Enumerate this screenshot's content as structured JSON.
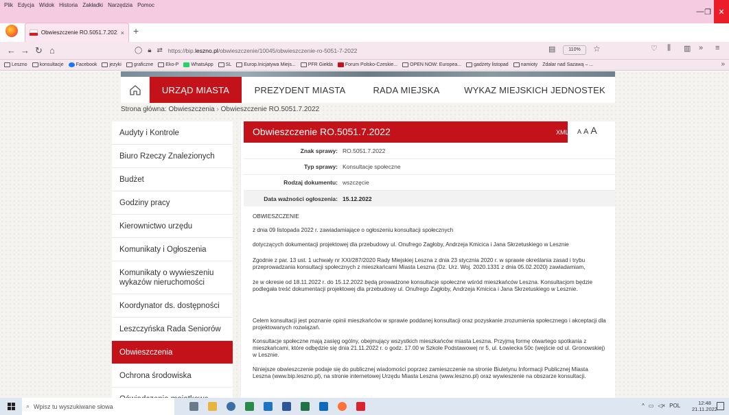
{
  "browser": {
    "menu": [
      "Plik",
      "Edycja",
      "Widok",
      "Historia",
      "Zakładki",
      "Narzędzia",
      "Pomoc"
    ],
    "tab_title": "Obwieszczenie RO.5051.7.2022",
    "tab_close": "×",
    "new_tab": "+",
    "url_prefix": "https://bip.",
    "url_domain": "leszno.pl",
    "url_path": "/obwieszczenie/10045/obwieszczenie-ro-5051-7-2022",
    "zoom": "110%",
    "bookmarks": [
      "Leszno",
      "konsultacje",
      "Facebook",
      "jezyki",
      "graficzne",
      "Eko-P",
      "WhatsApp",
      "SL",
      "Europ.Inicjatywa Miejs...",
      "PFR Giełda",
      "Forum Polsko-Czeskie...",
      "OPEN NOW: Europea...",
      "gadżety listopad",
      "namioty",
      "Zdalar nad Sazawą – ..."
    ]
  },
  "nav": {
    "items": [
      "URZĄD MIASTA",
      "PREZYDENT MIASTA",
      "RADA MIEJSKA",
      "WYKAZ MIEJSKICH JEDNOSTEK"
    ]
  },
  "breadcrumb": {
    "root": "Strona główna: Obwieszczenia",
    "sep": "›",
    "current": "Obwieszczenie RO.5051.7.2022"
  },
  "sidebar": {
    "items": [
      "Audyty i Kontrole",
      "Biuro Rzeczy Znalezionych",
      "Budżet",
      "Godziny pracy",
      "Kierownictwo urzędu",
      "Komunikaty i Ogłoszenia",
      "Komunikaty o wywieszeniu wykazów nieruchomości",
      "Koordynator ds. dostępności",
      "Leszczyńska Rada Seniorów",
      "Obwieszczenia",
      "Ochrona środowiska",
      "Oświadczenia majątkowe"
    ]
  },
  "doc": {
    "title": "Obwieszczenie RO.5051.7.2022",
    "xml": "XML",
    "font_small": "A",
    "font_medium": "A",
    "font_large": "A",
    "meta": [
      {
        "label": "Znak sprawy:",
        "value": "RO.5051.7.2022"
      },
      {
        "label": "Typ sprawy:",
        "value": "Konsultacje społeczne"
      },
      {
        "label": "Rodzaj dokumentu:",
        "value": "wszczęcie"
      },
      {
        "label": "Data ważności ogłoszenia:",
        "value": "15.12.2022"
      }
    ],
    "paragraphs": [
      "OBWIESZCZENIE",
      "z dnia 09 listopada 2022 r. zawiadamiające o ogłoszeniu konsultacji społecznych",
      "dotyczących dokumentacji projektowej dla przebudowy ul. Onufrego Zagłoby, Andrzeja Kmicica i Jana Skrzetuskiego w Lesznie",
      "Zgodnie z par. 13 ust. 1 uchwały nr XXI/287/2020 Rady Miejskiej Leszna z dnia 23 stycznia 2020 r. w sprawie określania zasad i trybu przeprowadzania konsultacji społecznych z mieszkańcami Miasta Leszna (Dz. Urz. Woj. 2020.1331 z dnia 05.02.2020) zawiadamiam,",
      "że w okresie od 18.11.2022 r. do 15.12.2022 będą prowadzone konsultacje społeczne wśród mieszkańców Leszna. Konsultacjom będzie podlegała treść dokumentacji projektowej dla przebudowy ul. Onufrego Zagłoby, Andrzeja Kmicica i Jana Skrzetuskiego w Lesznie.",
      "Celem konsultacji jest poznanie opinii mieszkańców w sprawie poddanej konsultacji oraz pozyskanie zrozumienia społecznego i akceptacji dla projektowanych rozwiązań.",
      "Konsultacje społeczne mają zasięg ogólny, obejmujący wszystkich mieszkańców miasta Leszna. Przyjmą formę otwartego spotkania z mieszkańcami, które odbędzie się dnia 21.11.2022 r. o godz. 17.00 w Szkole Podstawowej nr 5, ul. Łowiecka 50c (wejście od ul. Gronowskiej) w Lesznie.",
      "Niniejsze obwieszczenie podaje się do publicznej wiadomości poprzez zamieszczenie na stronie Biuletynu Informacji Publicznej Miasta Leszna (www.bip.leszno.pl), na stronie internetowej Urzędu Miasta Leszna (www.leszno.pl) oraz wywieszenie na obszarze konsultacji."
    ]
  },
  "taskbar": {
    "search_placeholder": "Wpisz tu wyszukiwane słowa",
    "language": "POL",
    "time": "12:48",
    "date": "21.11.2022"
  },
  "colors": {
    "brand_red": "#c4121a",
    "chrome_pink": "#f4cbe0"
  }
}
